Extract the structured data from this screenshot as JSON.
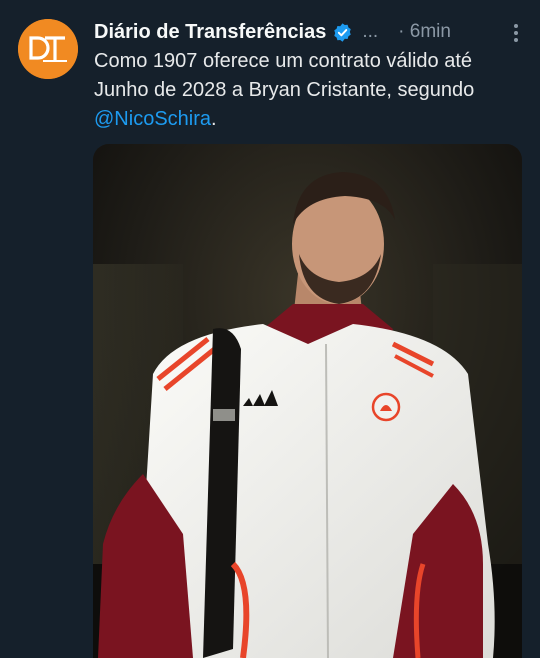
{
  "tweet": {
    "author_name": "Diário de Transferências",
    "verified_icon": "verified-badge-icon",
    "handle_truncated": "...",
    "time": "· 6min",
    "text_before": "Como 1907 oferece um contrato válido até Junho de 2028 a Bryan Cristante, segundo ",
    "mention": "@NicoSchira",
    "text_after": ".",
    "avatar_letters": "DT",
    "media_alt": "photo of football player in white and red tracksuit jacket with backpack strap"
  },
  "colors": {
    "background": "#15202b",
    "mention": "#1d9bf0",
    "avatar": "#f18a22",
    "verified": "#1d9bf0",
    "jacket_red": "#7a1420",
    "jacket_white": "#f2f2f0"
  }
}
